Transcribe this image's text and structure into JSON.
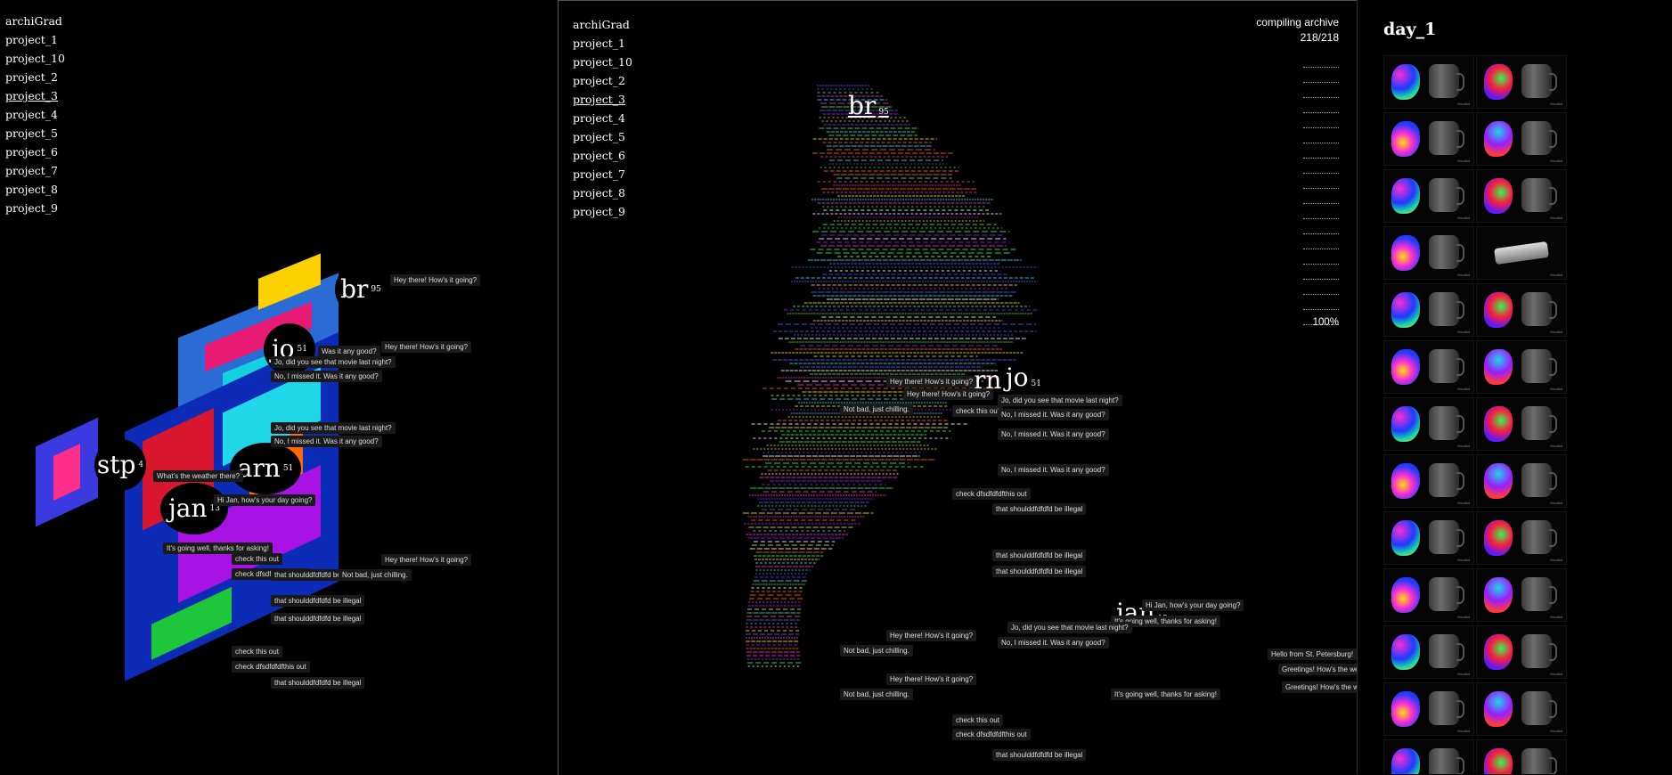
{
  "left": {
    "nav": [
      "archiGrad",
      "project_1",
      "project_10",
      "project_2",
      "project_3",
      "project_4",
      "project_5",
      "project_6",
      "project_7",
      "project_8",
      "project_9"
    ],
    "nodes": [
      {
        "label": "br",
        "num": "95"
      },
      {
        "label": "jo",
        "num": "51"
      },
      {
        "label": "stp",
        "num": "4"
      },
      {
        "label": "arn",
        "num": "51"
      },
      {
        "label": "jan",
        "num": "13"
      }
    ],
    "messages": [
      "Hey there! How's it going?",
      "Jo, did you see that movie last night?",
      "Was it any good?",
      "No, I missed it. Was it any good?",
      "Hey there! How's it going?",
      "No, I missed it. Was it any good?",
      "Jo, did you see that movie last night?",
      "What's the weather there?",
      "Hi Jan, how's your day going?",
      "It's going well, thanks for asking!",
      "check this out",
      "check dfsdfdfdfthis out",
      "that shoulddfdfdfd be illegal",
      "Not bad, just chilling.",
      "that shoulddfdfdfd be illegal",
      "that shoulddfdfdfd be illegal",
      "check this out",
      "check dfsdfdfdfthis out",
      "that shoulddfdfdfd be illegal",
      "Hey there! How's it going?"
    ]
  },
  "mid": {
    "nav": [
      "archiGrad",
      "project_1",
      "project_10",
      "project_2",
      "project_3",
      "project_4",
      "project_5",
      "project_6",
      "project_7",
      "project_8",
      "project_9"
    ],
    "status_title": "compiling archive",
    "status_count": "218/218",
    "percent": "100%",
    "nodes": [
      {
        "label": "br",
        "num": "95"
      },
      {
        "label": "rn",
        "num": ""
      },
      {
        "label": "jo",
        "num": "51"
      },
      {
        "label": "jan",
        "num": "13"
      }
    ],
    "messages": [
      "Hey there! How's it going?",
      "Hey there! How's it going?",
      "Not bad, just chilling.",
      "check this out",
      "Jo, did you see that movie last night?",
      "No, I missed it. Was it any good?",
      "No, I missed it. Was it any good?",
      "No, I missed it. Was it any good?",
      "check dfsdfdfdfthis out",
      "that shoulddfdfdfd be illegal",
      "that shoulddfdfdfd be illegal",
      "that shoulddfdfdfd be illegal",
      "Hi Jan, how's your day going?",
      "It's going well, thanks for asking!",
      "Hey there! How's it going?",
      "Not bad, just chilling.",
      "Jo, did you see that movie last night?",
      "No, I missed it. Was it any good?",
      "Hey there! How's it going?",
      "Not bad, just chilling.",
      "It's going well, thanks for asking!",
      "check this out",
      "check dfsdfdfdfthis out",
      "that shoulddfdfdfd be illegal",
      "Hello from St. Petersburg!",
      "Greetings! How's the weather there?",
      "Greetings! How's the weather there?"
    ]
  },
  "right": {
    "title": "day_1",
    "cells": 26,
    "caption": "Houdini"
  }
}
